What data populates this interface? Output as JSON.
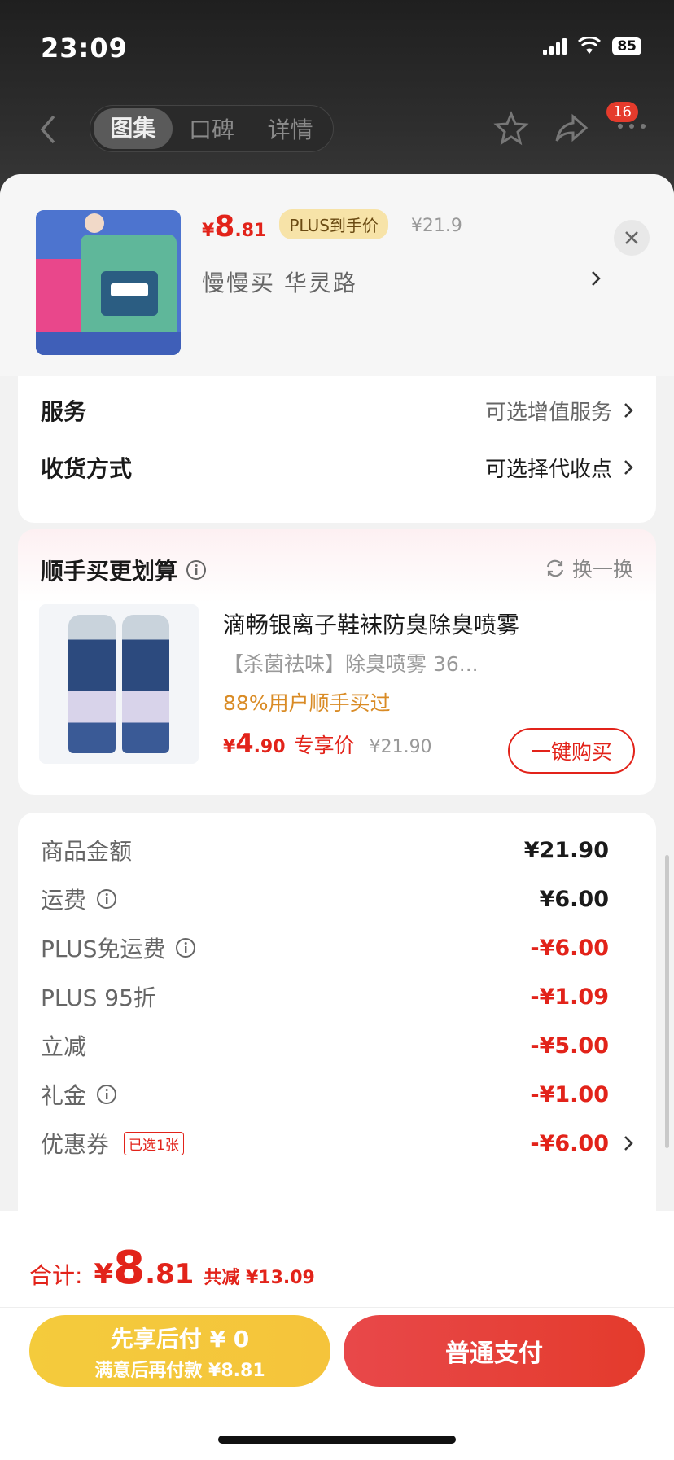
{
  "status": {
    "time": "23:09",
    "battery": "85"
  },
  "nav": {
    "tabs": [
      "图集",
      "口碑",
      "详情"
    ],
    "active_tab": 0,
    "message_badge": "16"
  },
  "product": {
    "price_symbol": "¥",
    "price_int": "8",
    "price_dec": ".81",
    "plus_tag": "PLUS到手价",
    "original_price": "¥21.9",
    "address": "慢慢买 华灵路"
  },
  "options": {
    "service": {
      "label": "服务",
      "value": "可选增值服务"
    },
    "delivery": {
      "label": "收货方式",
      "value": "可选择代收点"
    }
  },
  "recommend": {
    "title": "顺手买更划算",
    "swap": "换一换",
    "name": "滴畅银离子鞋袜防臭除臭喷雾",
    "subtitle": "【杀菌祛味】除臭喷雾 36...",
    "buy_rate": "88%用户顺手买过",
    "price_symbol": "¥",
    "price_int": "4",
    "price_dec": ".90",
    "exclusive": "专享价",
    "original_price": "¥21.90",
    "buy_button": "一键购买"
  },
  "fees": [
    {
      "label": "商品金额",
      "value": "¥21.90",
      "red": false,
      "info": false
    },
    {
      "label": "运费",
      "value": "¥6.00",
      "red": false,
      "info": true
    },
    {
      "label": "PLUS免运费",
      "value": "-¥6.00",
      "red": true,
      "info": true
    },
    {
      "label": "PLUS 95折",
      "value": "-¥1.09",
      "red": true,
      "info": false
    },
    {
      "label": "立减",
      "value": "-¥5.00",
      "red": true,
      "info": false
    },
    {
      "label": "礼金",
      "value": "-¥1.00",
      "red": true,
      "info": true
    },
    {
      "label": "优惠券",
      "value": "-¥6.00",
      "red": true,
      "info": false,
      "tag": "已选1张",
      "chevron": true
    }
  ],
  "footer": {
    "total_label": "合计:",
    "total_symbol": "¥",
    "total_int": "8",
    "total_dec": ".81",
    "total_saving": "共减 ¥13.09",
    "pay_later_line1": "先享后付 ¥ 0",
    "pay_later_line2": "满意后再付款 ¥8.81",
    "pay_normal": "普通支付"
  },
  "colors": {
    "accent_red": "#e2231a",
    "pay_later_yellow": "#f4c83c",
    "buy_rate_orange": "#d98b25"
  }
}
